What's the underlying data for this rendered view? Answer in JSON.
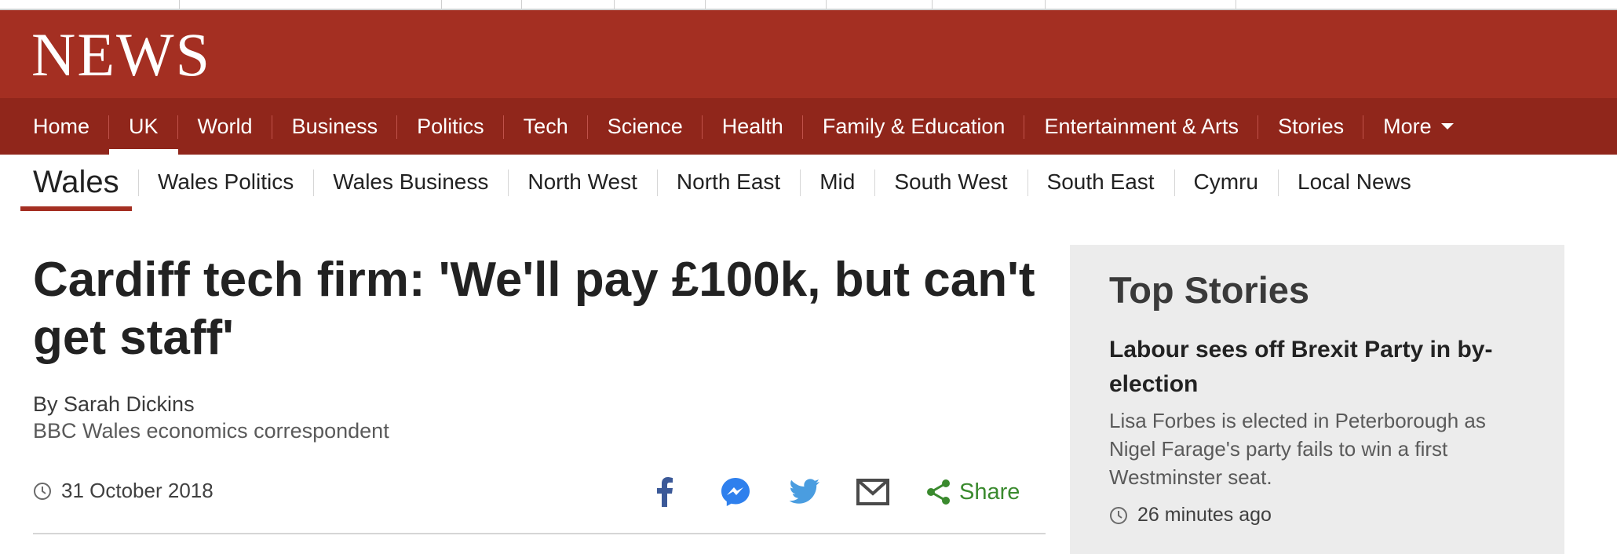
{
  "brand": {
    "logo_text": "NEWS",
    "primary_color": "#a42f22",
    "nav_color": "#90261b"
  },
  "nav": {
    "items": [
      {
        "label": "Home"
      },
      {
        "label": "UK",
        "active": true
      },
      {
        "label": "World"
      },
      {
        "label": "Business"
      },
      {
        "label": "Politics"
      },
      {
        "label": "Tech"
      },
      {
        "label": "Science"
      },
      {
        "label": "Health"
      },
      {
        "label": "Family & Education"
      },
      {
        "label": "Entertainment & Arts"
      },
      {
        "label": "Stories"
      },
      {
        "label": "More"
      }
    ]
  },
  "subnav": {
    "section": "Wales",
    "items": [
      "Wales Politics",
      "Wales Business",
      "North West",
      "North East",
      "Mid",
      "South West",
      "South East",
      "Cymru",
      "Local News"
    ]
  },
  "article": {
    "headline": "Cardiff tech firm: 'We'll pay £100k, but can't get staff'",
    "byline_name": "By Sarah Dickins",
    "byline_role": "BBC Wales economics correspondent",
    "date": "31 October 2018",
    "share_label": "Share",
    "share_icons": [
      "facebook-icon",
      "messenger-icon",
      "twitter-icon",
      "email-icon",
      "share-icon"
    ],
    "share_color": "#3a8a2e"
  },
  "top_stories": {
    "title": "Top Stories",
    "story": {
      "headline": "Labour sees off Brexit Party in by-election",
      "summary": "Lisa Forbes is elected in Peterborough as Nigel Farage's party fails to win a first Westminster seat.",
      "time": "26 minutes ago"
    }
  }
}
